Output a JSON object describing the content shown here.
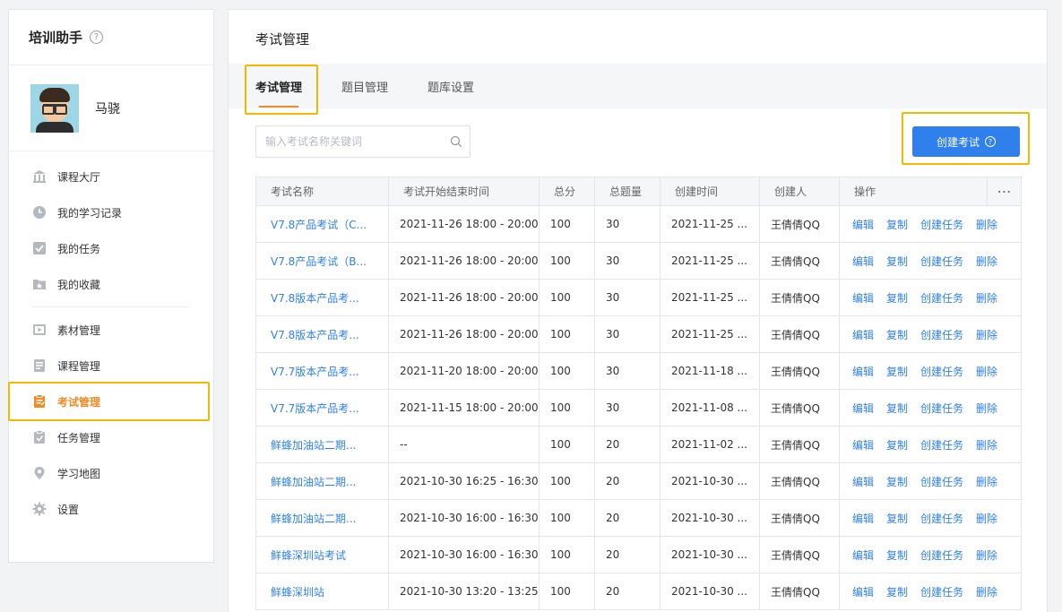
{
  "app": {
    "title": "培训助手",
    "help": "?"
  },
  "user": {
    "name": "马骁"
  },
  "nav": [
    {
      "label": "课程大厅",
      "icon": "building-icon"
    },
    {
      "label": "我的学习记录",
      "icon": "clock-icon"
    },
    {
      "label": "我的任务",
      "icon": "checkbox-icon"
    },
    {
      "label": "我的收藏",
      "icon": "star-folder-icon"
    },
    {
      "label": "素材管理",
      "icon": "media-icon"
    },
    {
      "label": "课程管理",
      "icon": "list-doc-icon"
    },
    {
      "label": "考试管理",
      "icon": "exam-icon",
      "active": true
    },
    {
      "label": "任务管理",
      "icon": "task-icon"
    },
    {
      "label": "学习地图",
      "icon": "map-pin-icon"
    },
    {
      "label": "设置",
      "icon": "gear-icon"
    }
  ],
  "page": {
    "title": "考试管理"
  },
  "tabs": [
    {
      "label": "考试管理",
      "active": true
    },
    {
      "label": "题目管理"
    },
    {
      "label": "题库设置"
    }
  ],
  "search": {
    "placeholder": "输入考试名称关键词",
    "value": ""
  },
  "create_button": {
    "label": "创建考试",
    "help": "?"
  },
  "table": {
    "columns": [
      "考试名称",
      "考试开始结束时间",
      "总分",
      "总题量",
      "创建时间",
      "创建人",
      "操作",
      "⋯"
    ],
    "actions": [
      "编辑",
      "复制",
      "创建任务",
      "删除"
    ],
    "rows": [
      {
        "name": "V7.8产品考试（C...",
        "period": "2021-11-26 18:00 - 20:00",
        "score": "100",
        "count": "30",
        "created": "2021-11-25 ...",
        "creator": "王倩倩QQ"
      },
      {
        "name": "V7.8产品考试（B...",
        "period": "2021-11-26 18:00 - 20:00",
        "score": "100",
        "count": "30",
        "created": "2021-11-25 ...",
        "creator": "王倩倩QQ"
      },
      {
        "name": "V7.8版本产品考...",
        "period": "2021-11-26 18:00 - 20:00",
        "score": "100",
        "count": "30",
        "created": "2021-11-25 ...",
        "creator": "王倩倩QQ"
      },
      {
        "name": "V7.8版本产品考...",
        "period": "2021-11-26 18:00 - 20:00",
        "score": "100",
        "count": "30",
        "created": "2021-11-25 ...",
        "creator": "王倩倩QQ"
      },
      {
        "name": "V7.7版本产品考...",
        "period": "2021-11-20 18:00 - 20:00",
        "score": "100",
        "count": "30",
        "created": "2021-11-18 ...",
        "creator": "王倩倩QQ"
      },
      {
        "name": "V7.7版本产品考...",
        "period": "2021-11-15 18:00 - 20:00",
        "score": "100",
        "count": "30",
        "created": "2021-11-08 ...",
        "creator": "王倩倩QQ"
      },
      {
        "name": "鲜蜂加油站二期...",
        "period": "--",
        "score": "100",
        "count": "20",
        "created": "2021-11-02 ...",
        "creator": "王倩倩QQ"
      },
      {
        "name": "鲜蜂加油站二期...",
        "period": "2021-10-30 16:25 - 16:30",
        "score": "100",
        "count": "20",
        "created": "2021-10-30 ...",
        "creator": "王倩倩QQ"
      },
      {
        "name": "鲜蜂加油站二期...",
        "period": "2021-10-30 16:00 - 16:30",
        "score": "100",
        "count": "20",
        "created": "2021-10-30 ...",
        "creator": "王倩倩QQ"
      },
      {
        "name": "鲜蜂深圳站考试",
        "period": "2021-10-30 16:00 - 16:30",
        "score": "100",
        "count": "20",
        "created": "2021-10-30 ...",
        "creator": "王倩倩QQ"
      },
      {
        "name": "鲜蜂深圳站",
        "period": "2021-10-30 13:20 - 13:25",
        "score": "100",
        "count": "20",
        "created": "2021-10-30 ...",
        "creator": "王倩倩QQ"
      }
    ]
  },
  "colors": {
    "accent": "#2f80ed",
    "active_nav": "#f08a24",
    "highlight": "#f5b800"
  }
}
